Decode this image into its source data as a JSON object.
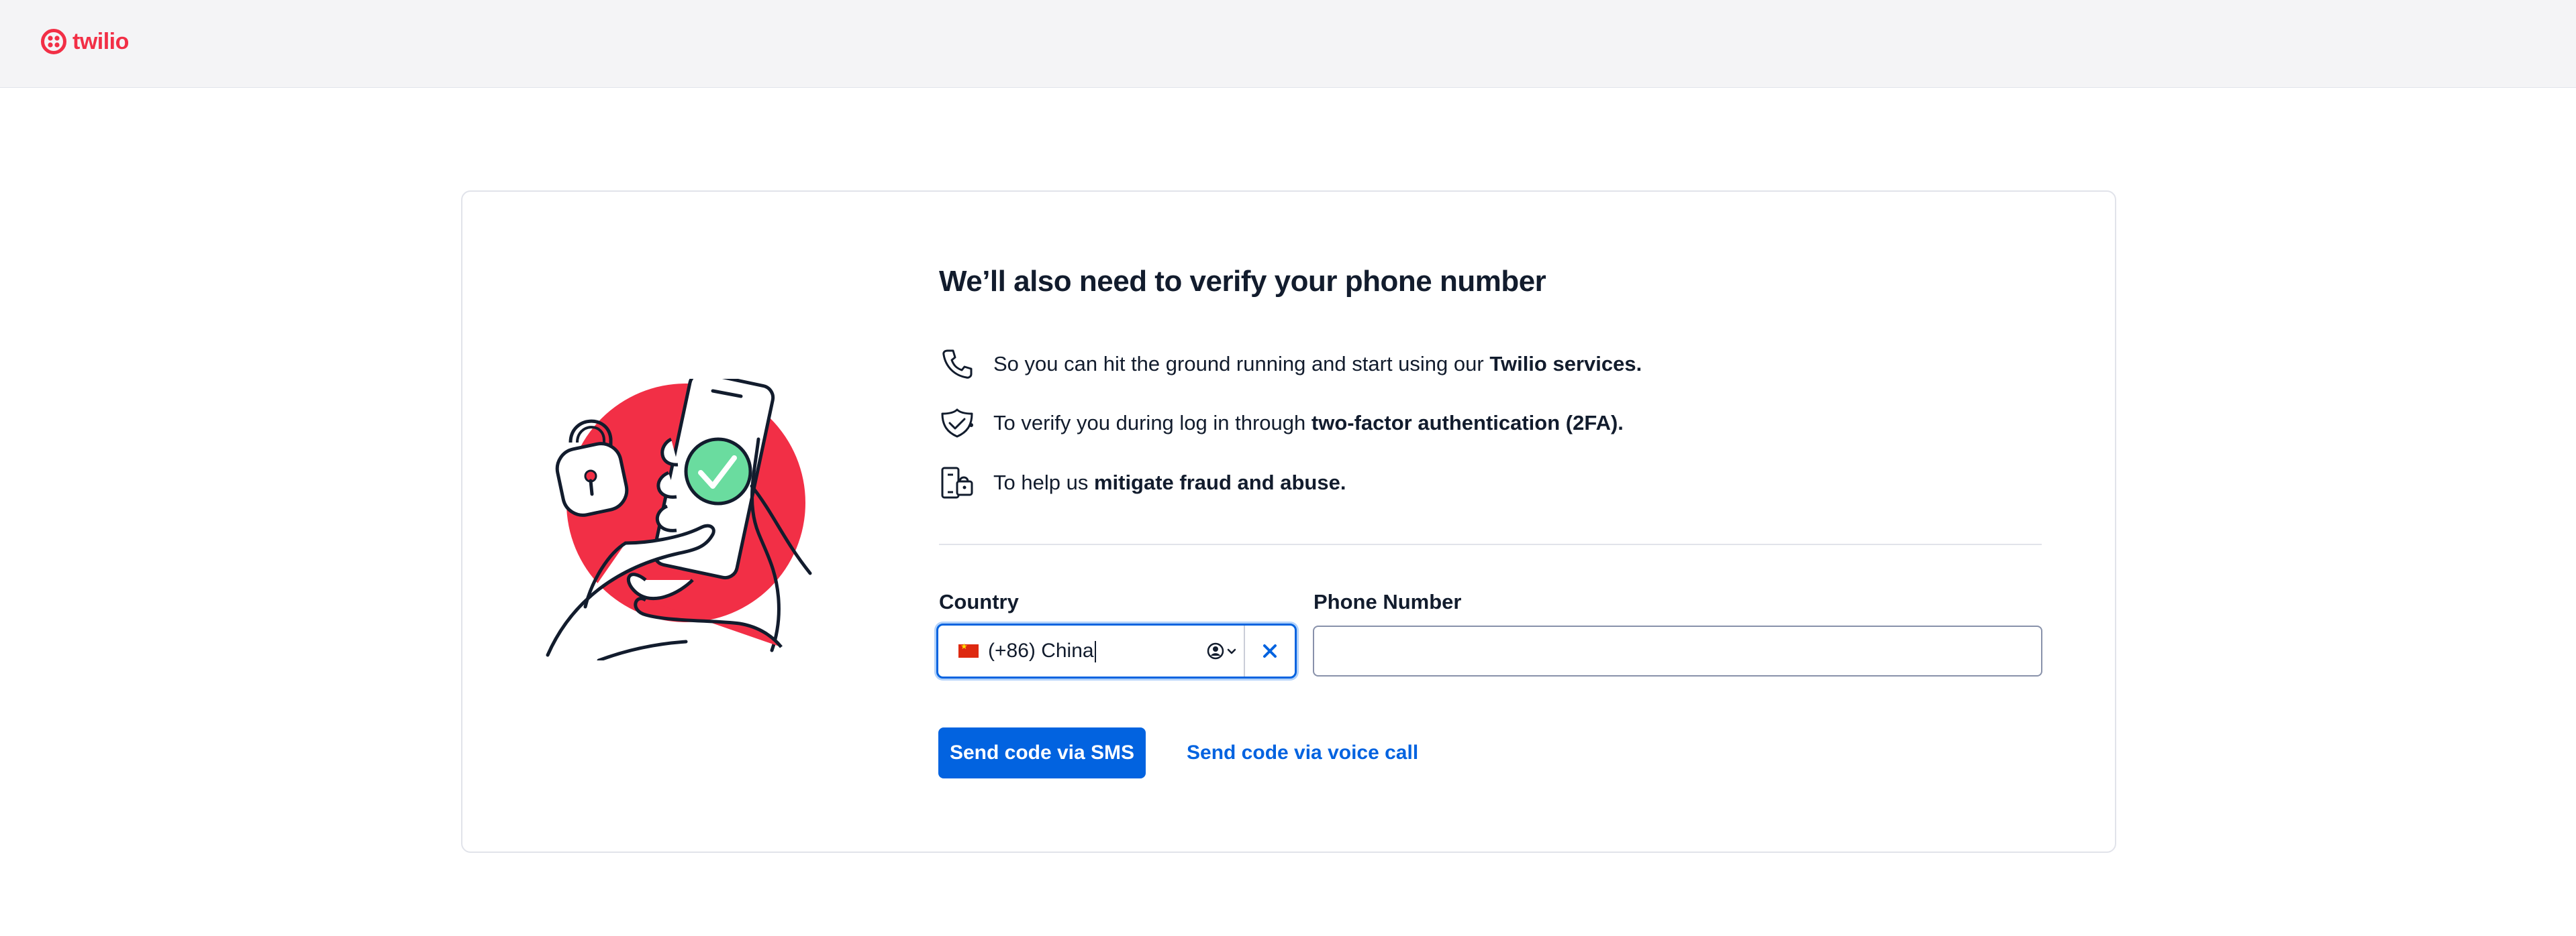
{
  "header": {
    "logo_text": "twilio",
    "brand_color": "#f22f46"
  },
  "verify": {
    "title": "We’ll also need to verify your phone number",
    "reasons": [
      {
        "icon": "phone-icon",
        "prefix": "So you can hit the ground running and start using our ",
        "bold": "Twilio services."
      },
      {
        "icon": "shield-check-icon",
        "prefix": "To verify you during log in through ",
        "bold": "two-factor authentication (2FA)."
      },
      {
        "icon": "fraud-lock-icon",
        "prefix": "To help us ",
        "bold": "mitigate fraud and abuse."
      }
    ]
  },
  "form": {
    "country_label": "Country",
    "country_value": "(+86) China",
    "country_flag": "china-flag-icon",
    "phone_label": "Phone Number",
    "phone_value": "",
    "accent_color": "#0263e0"
  },
  "actions": {
    "sms_label": "Send code via SMS",
    "voice_label": "Send code via voice call"
  }
}
